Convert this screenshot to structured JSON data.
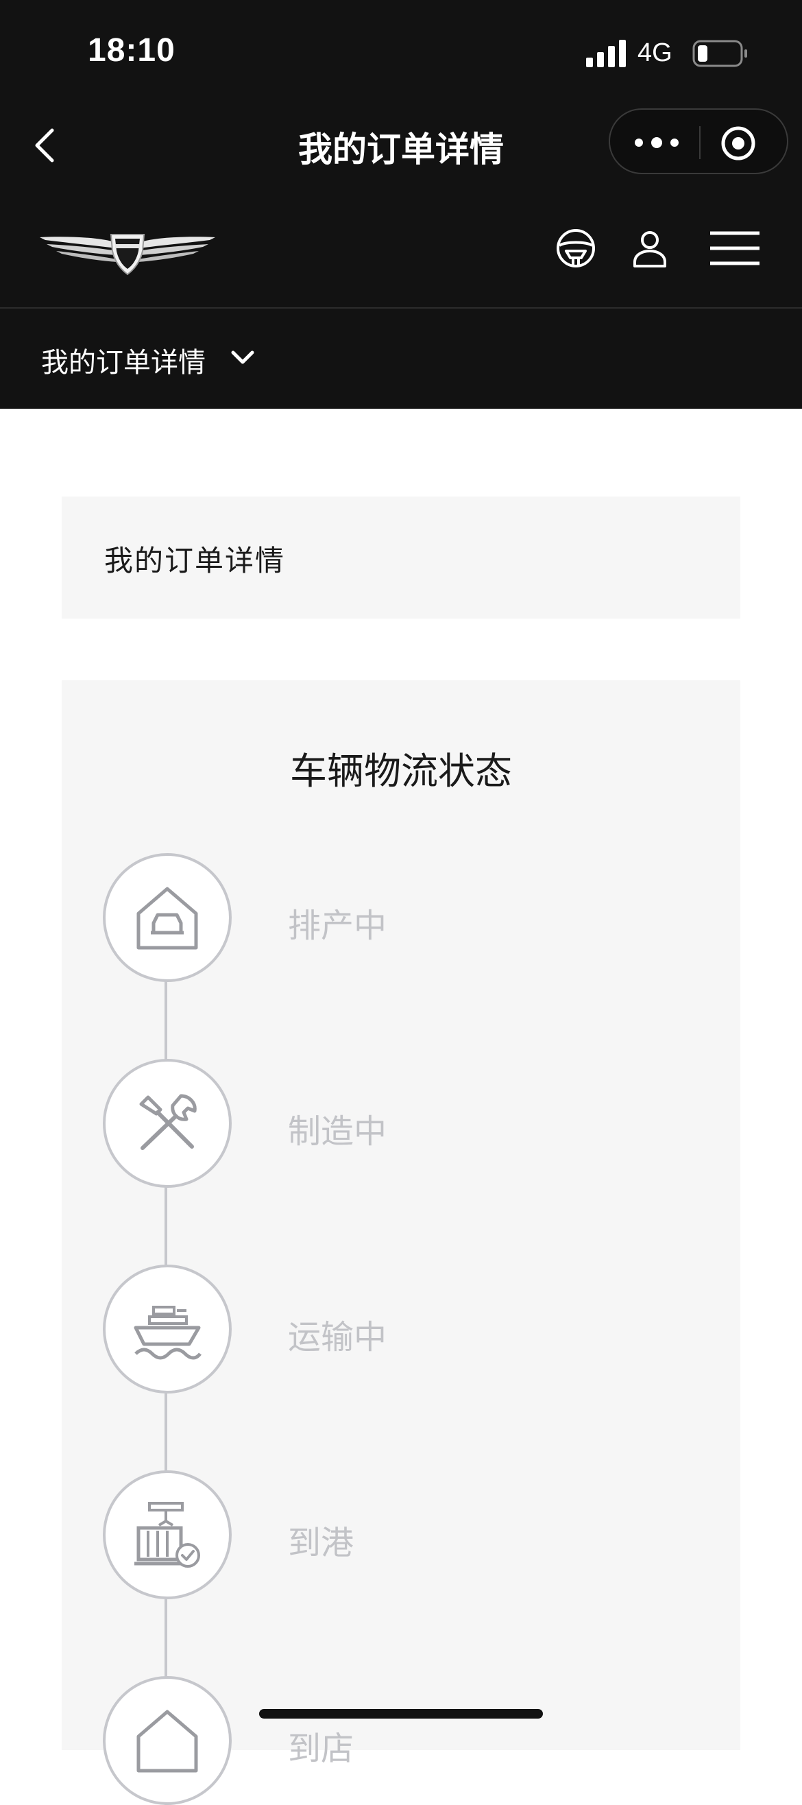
{
  "status_bar": {
    "time": "18:10",
    "network": "4G"
  },
  "nav_bar": {
    "title": "我的订单详情"
  },
  "section_bar": {
    "selected": "我的订单详情"
  },
  "order": {
    "title": "我的订单详情"
  },
  "logistics": {
    "title": "车辆物流状态",
    "steps": [
      {
        "label": "排产中",
        "icon": "factory-icon"
      },
      {
        "label": "制造中",
        "icon": "tools-icon"
      },
      {
        "label": "运输中",
        "icon": "ship-icon"
      },
      {
        "label": "到港",
        "icon": "port-container-icon"
      },
      {
        "label": "到店",
        "icon": "store-icon"
      }
    ]
  },
  "colors": {
    "header_bg": "#121212",
    "card_bg": "#f6f6f6",
    "inactive_gray": "#c6c7cc",
    "inactive_text": "#c2c3c7"
  }
}
